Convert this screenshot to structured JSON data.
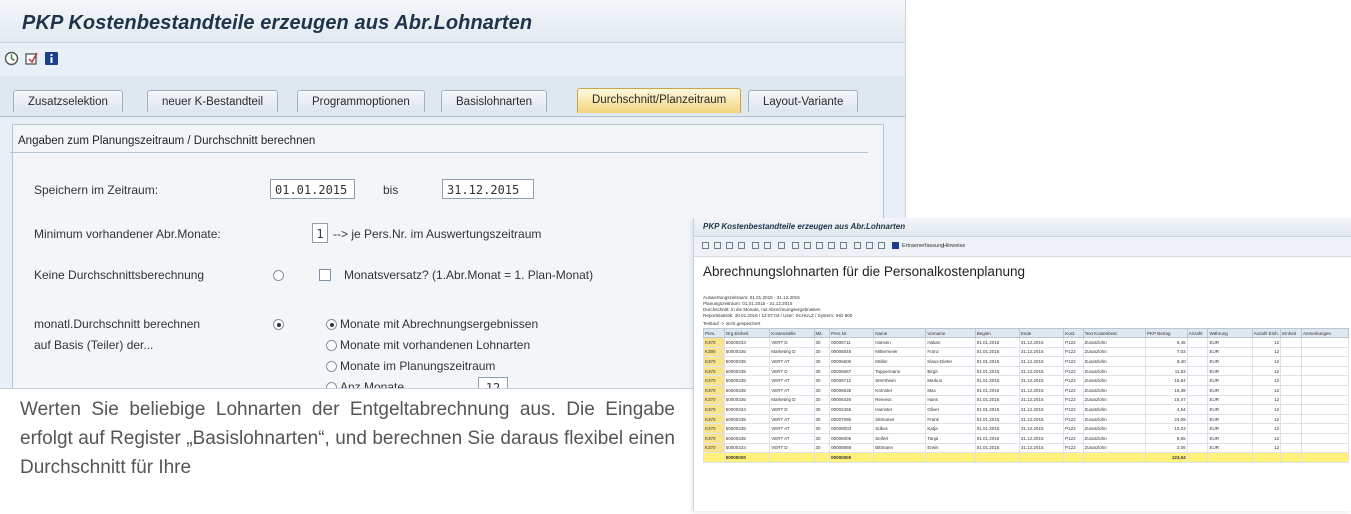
{
  "window": {
    "title": "PKP Kostenbestandteile erzeugen aus Abr.Lohnarten",
    "toolbar_icons": [
      "execute-icon",
      "variant-icon",
      "info-icon"
    ]
  },
  "tabs": [
    {
      "label": "Zusatzselektion",
      "active": false
    },
    {
      "label": "neuer K-Bestandteil",
      "active": false
    },
    {
      "label": "Programmoptionen",
      "active": false
    },
    {
      "label": "Basislohnarten",
      "active": false
    },
    {
      "label": "Durchschnitt/Planzeitraum",
      "active": true
    },
    {
      "label": "Layout-Variante",
      "active": false
    }
  ],
  "form": {
    "group_title": "Angaben zum Planungszeitraum / Durchschnitt berechnen",
    "speichern_label": "Speichern im Zeitraum:",
    "date_from": "01.01.2015",
    "bis_label": "bis",
    "date_to": "31.12.2015",
    "minimum_label": "Minimum vorhandener Abr.Monate:",
    "minimum_value": "1",
    "minimum_suffix": "--> je Pers.Nr. im Auswertungszeitraum",
    "keine_label": "Keine Durchschnittsberechnung",
    "monatsversatz_label": "Monatsversatz? (1.Abr.Monat = 1. Plan-Monat)",
    "monatl_label_1": "monatl.Durchschnitt berechnen",
    "monatl_label_2": "auf Basis (Teiler) der...",
    "option_1": "Monate mit Abrechnungsergebnissen",
    "option_2": "Monate mit vorhandenen Lohnarten",
    "option_3": "Monate im Planungszeitraum",
    "option_4_partial": "Anz.Monate",
    "option_4_value": "12"
  },
  "description": "Werten Sie beliebige Lohnarten der Entgeltabrechnung aus. Die Eingabe erfolgt auf Register „Basislohnarten“, und berechnen Sie daraus flexibel einen Durchschnitt für Ihre",
  "report": {
    "window_title": "PKP Kostenbestandteile erzeugen aus Abr.Lohnarten",
    "toolbar_text_1": "Ertraenerfassung",
    "toolbar_text_2": "Hinweise",
    "heading": "Abrechnungslohnarten für die Personalkostenplanung",
    "meta": [
      "Auswertungszeitraum:    01.01.2015 - 31.12.2015",
      "Planungszeitraum:       01.01.2015 - 31.12.2015",
      "Durchschnitt:           in die Monate, mit Abrechnungsergebnissen",
      "Reportstatistik:        30.01.2016 / 12:07:03 / User: SCHULZ / System: IHD 800"
    ],
    "testlauf": "Testlauf -> nicht gespeichert",
    "columns": [
      "Pers.",
      "Org.Einheit",
      "Kostenstelle",
      "Mit.",
      "Pers.Nr.",
      "Name",
      "Vorname",
      "Beginn",
      "Ende",
      "Kost.",
      "Text Kostenbest.",
      "PKP Betrag",
      "Anzahl",
      "Währung",
      "Anzahl Einh.",
      "Einheit",
      "Anmerkungen"
    ],
    "rows": [
      [
        "K370",
        "50000334",
        "VERT D",
        "30",
        "00006711",
        "Hansen",
        "Hakan",
        "01.01.2015",
        "31.12.2015",
        "P122",
        "Zusatzlohn",
        "8,46",
        "",
        "EUR",
        "12",
        "",
        ""
      ],
      [
        "K390",
        "50000336",
        "Marketing D",
        "30",
        "00006045",
        "Mittermeier",
        "Franz",
        "01.01.2015",
        "31.12.2015",
        "P122",
        "Zusatzlohn",
        "7,03",
        "",
        "EUR",
        "12",
        "",
        ""
      ],
      [
        "K370",
        "50000335",
        "VERT AT",
        "30",
        "00006600",
        "Müller",
        "Klaus-Dieter",
        "01.01.2015",
        "31.12.2015",
        "P122",
        "Zusatzlohn",
        "9,40",
        "",
        "EUR",
        "12",
        "",
        ""
      ],
      [
        "K370",
        "50000335",
        "VERT D",
        "30",
        "00006687",
        "Tappermann",
        "Birgit",
        "01.01.2015",
        "31.12.2015",
        "P122",
        "Zusatzlohn",
        "11,83",
        "",
        "EUR",
        "12",
        "",
        ""
      ],
      [
        "K370",
        "50000335",
        "VERT AT",
        "30",
        "00006712",
        "Sternheim",
        "Markus",
        "01.01.2015",
        "31.12.2015",
        "P122",
        "Zusatzlohn",
        "15,84",
        "",
        "EUR",
        "12",
        "",
        ""
      ],
      [
        "K370",
        "50000335",
        "VERT AT",
        "30",
        "00006535",
        "Körnster",
        "Max",
        "01.01.2015",
        "31.12.2015",
        "P122",
        "Zusatzlohn",
        "16,38",
        "",
        "EUR",
        "12",
        "",
        ""
      ],
      [
        "K370",
        "50000336",
        "Marketing D",
        "30",
        "00006426",
        "Reiness",
        "Hans",
        "01.01.2015",
        "31.12.2015",
        "P122",
        "Zusatzlohn",
        "15,47",
        "",
        "EUR",
        "12",
        "",
        ""
      ],
      [
        "K370",
        "50000334",
        "VERT D",
        "30",
        "00002455",
        "Hamster",
        "Oliver",
        "01.01.2015",
        "31.12.2015",
        "P122",
        "Zusatzlohn",
        "4,54",
        "",
        "EUR",
        "12",
        "",
        ""
      ],
      [
        "K370",
        "50000335",
        "VERT AT",
        "30",
        "00007095",
        "Sittmaner",
        "Frank",
        "01.01.2015",
        "31.12.2015",
        "P122",
        "Zusatzlohn",
        "24,09",
        "",
        "EUR",
        "12",
        "",
        ""
      ],
      [
        "K370",
        "50000335",
        "VERT AT",
        "30",
        "00008003",
        "Sdkus",
        "Katja",
        "01.01.2015",
        "31.12.2015",
        "P122",
        "Zusatzlohn",
        "10,03",
        "",
        "EUR",
        "12",
        "",
        ""
      ],
      [
        "K370",
        "50000335",
        "VERT AT",
        "30",
        "00006005",
        "Seifert",
        "Tanja",
        "01.01.2015",
        "31.12.2015",
        "P122",
        "Zusatzlohn",
        "8,55",
        "",
        "EUR",
        "12",
        "",
        ""
      ],
      [
        "K370",
        "50000334",
        "VERT D",
        "30",
        "00006888",
        "Bittmann",
        "Erwin",
        "01.01.2015",
        "31.12.2015",
        "P122",
        "Zusatzlohn",
        "2,06",
        "",
        "EUR",
        "12",
        "",
        ""
      ]
    ],
    "sum_row": [
      "",
      "50000000",
      "",
      "",
      "00000000",
      "",
      "",
      "",
      "",
      "",
      "",
      "123,04",
      "",
      "",
      "",
      "",
      ""
    ]
  }
}
